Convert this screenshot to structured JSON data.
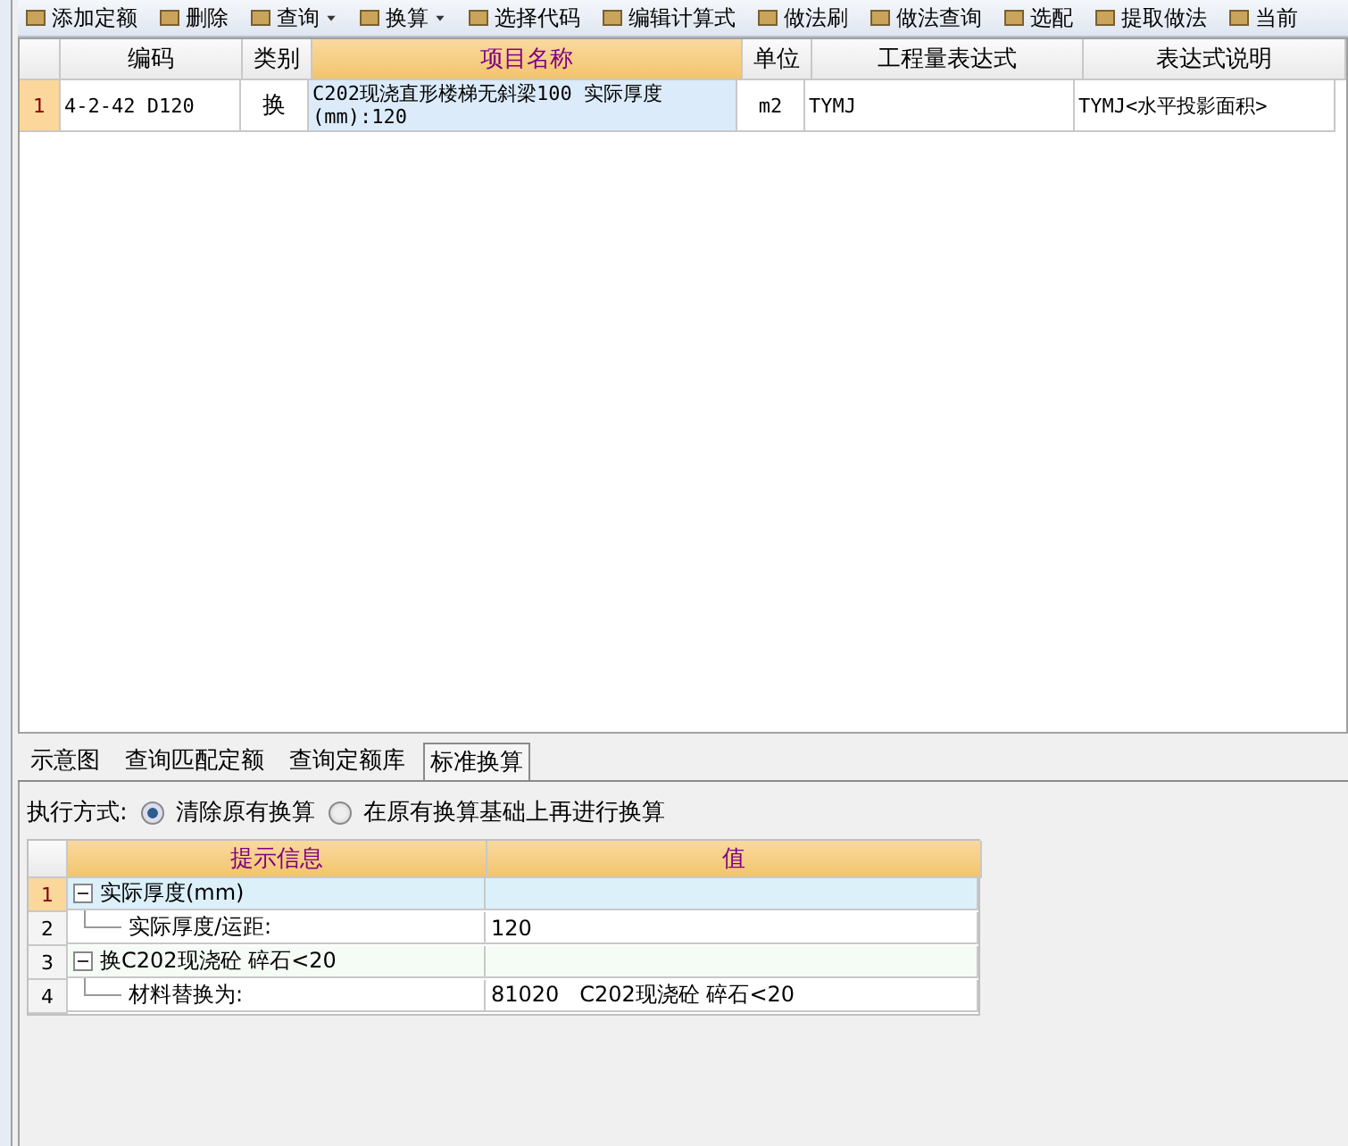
{
  "toolbar": [
    {
      "label": "添加定额"
    },
    {
      "label": "删除"
    },
    {
      "label": "查询",
      "dropdown": true
    },
    {
      "label": "换算",
      "dropdown": true
    },
    {
      "label": "选择代码"
    },
    {
      "label": "编辑计算式"
    },
    {
      "label": "做法刷"
    },
    {
      "label": "做法查询"
    },
    {
      "label": "选配"
    },
    {
      "label": "提取做法"
    },
    {
      "label": "当前"
    }
  ],
  "table": {
    "columns": [
      "编码",
      "类别",
      "项目名称",
      "单位",
      "工程量表达式",
      "表达式说明"
    ],
    "rows": [
      {
        "number": "1",
        "selected": true,
        "cells": [
          "4-2-42 D120",
          "换",
          "C202现浇直形楼梯无斜梁100 实际厚度(mm):120",
          "m2",
          "TYMJ",
          "TYMJ<水平投影面积>"
        ]
      }
    ]
  },
  "tabs": [
    {
      "label": "示意图",
      "selected": false
    },
    {
      "label": "查询匹配定额",
      "selected": false
    },
    {
      "label": "查询定额库",
      "selected": false
    },
    {
      "label": "标准换算",
      "selected": true
    }
  ],
  "execution_mode": {
    "label": "执行方式:",
    "options": [
      {
        "label": "清除原有换算",
        "selected": true
      },
      {
        "label": "在原有换算基础上再进行换算",
        "selected": false
      }
    ]
  },
  "conversion_table": {
    "columns": [
      "提示信息",
      "值"
    ],
    "rows": [
      {
        "number": "1",
        "kind": "group",
        "selected": true,
        "expanded": true,
        "info": "实际厚度(mm)",
        "value": ""
      },
      {
        "number": "2",
        "kind": "item",
        "selected": false,
        "info": "实际厚度/运距:",
        "value": "120"
      },
      {
        "number": "3",
        "kind": "group",
        "selected": false,
        "expanded": true,
        "info": "换C202现浇砼 碎石<20",
        "value": ""
      },
      {
        "number": "4",
        "kind": "item",
        "selected": false,
        "info": "材料替换为:",
        "value": "81020   C202现浇砼 碎石<20"
      }
    ]
  }
}
